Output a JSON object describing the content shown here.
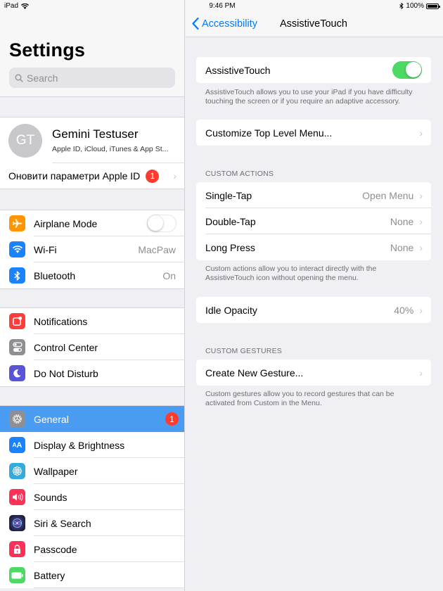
{
  "status_bar": {
    "device": "iPad",
    "time": "9:46 PM",
    "battery": "100%"
  },
  "master": {
    "title": "Settings",
    "search_placeholder": "Search",
    "profile": {
      "initials": "GT",
      "name": "Gemini Testuser",
      "subtitle": "Apple ID, iCloud, iTunes & App St..."
    },
    "apple_id_update": {
      "label": "Оновити параметри Apple ID",
      "badge": "1"
    },
    "groups": [
      [
        {
          "label": "Airplane Mode",
          "icon": "airplane-icon",
          "toggle": false
        },
        {
          "label": "Wi-Fi",
          "icon": "wifi-icon",
          "value": "MacPaw"
        },
        {
          "label": "Bluetooth",
          "icon": "bluetooth-icon",
          "value": "On"
        }
      ],
      [
        {
          "label": "Notifications",
          "icon": "notifications-icon"
        },
        {
          "label": "Control Center",
          "icon": "control-center-icon"
        },
        {
          "label": "Do Not Disturb",
          "icon": "moon-icon"
        }
      ],
      [
        {
          "label": "General",
          "icon": "gear-icon",
          "badge": "1",
          "selected": true
        },
        {
          "label": "Display & Brightness",
          "icon": "display-brightness-icon"
        },
        {
          "label": "Wallpaper",
          "icon": "wallpaper-icon"
        },
        {
          "label": "Sounds",
          "icon": "speaker-icon"
        },
        {
          "label": "Siri & Search",
          "icon": "siri-icon"
        },
        {
          "label": "Passcode",
          "icon": "lock-icon"
        },
        {
          "label": "Battery",
          "icon": "battery-icon"
        }
      ]
    ]
  },
  "detail": {
    "back_label": "Accessibility",
    "title": "AssistiveTouch",
    "assistive_touch": {
      "label": "AssistiveTouch",
      "enabled": true,
      "footer": "AssistiveTouch allows you to use your iPad if you have difficulty touching the screen or if you require an adaptive accessory."
    },
    "customize_menu": "Customize Top Level Menu...",
    "custom_actions": {
      "header": "CUSTOM ACTIONS",
      "rows": [
        {
          "label": "Single-Tap",
          "value": "Open Menu"
        },
        {
          "label": "Double-Tap",
          "value": "None"
        },
        {
          "label": "Long Press",
          "value": "None"
        }
      ],
      "footer": "Custom actions allow you to interact directly with the AssistiveTouch icon without opening the menu."
    },
    "idle_opacity": {
      "label": "Idle Opacity",
      "value": "40%"
    },
    "custom_gestures": {
      "header": "CUSTOM GESTURES",
      "create_label": "Create New Gesture...",
      "footer": "Custom gestures allow you to record gestures that can be activated from Custom in the Menu."
    }
  },
  "colors": {
    "accent": "#007aff",
    "selected_row": "#4a9cf3",
    "toggle_on": "#4cd964",
    "badge": "#ff3b30"
  }
}
